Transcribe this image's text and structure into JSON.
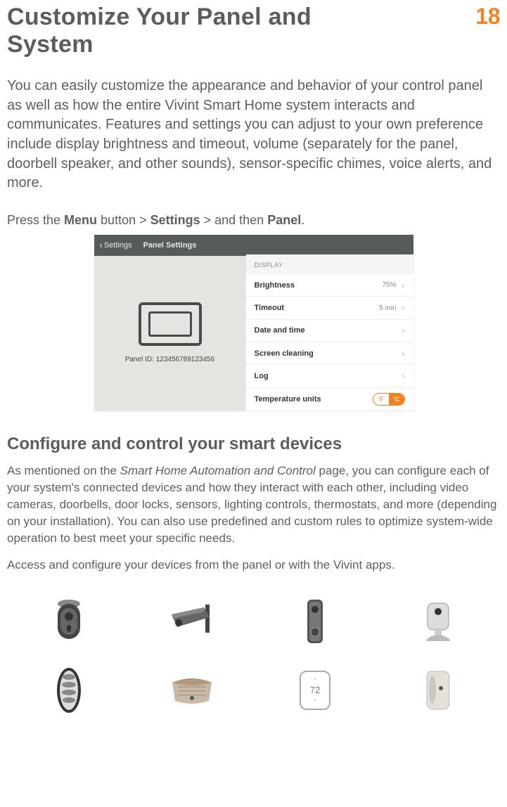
{
  "pageNumber": "18",
  "title": "Customize Your Panel and System",
  "intro": "You can easily customize the appearance and behavior of your control panel as well as how the entire Vivint Smart Home system interacts and communicates. Features and settings you can adjust to your own preference include display brightness and timeout, volume (separately for the panel, doorbell speaker, and other sounds), sensor-specific chimes, voice alerts, and more.",
  "navLine": {
    "prefix": "Press the ",
    "btn1": "Menu",
    "mid1": " button > ",
    "btn2": "Settings",
    "mid2": " > and then ",
    "btn3": "Panel",
    "suffix": "."
  },
  "panel": {
    "backLabel": "Settings",
    "titleLabel": "Panel Settings",
    "panelIdLabel": "Panel ID:",
    "panelIdValue": "123456789123456",
    "sectionLabel": "DISPLAY",
    "rows": {
      "brightness": {
        "label": "Brightness",
        "value": "75%"
      },
      "timeout": {
        "label": "Timeout",
        "value": "5 min"
      },
      "datetime": {
        "label": "Date and time"
      },
      "screen": {
        "label": "Screen cleaning"
      },
      "log": {
        "label": "Log"
      },
      "temp": {
        "label": "Temperature units",
        "f": "°F",
        "c": "°C"
      }
    }
  },
  "subhead": "Configure and control your smart devices",
  "body1a": "As mentioned on the ",
  "body1_em": "Smart Home Automation and Control",
  "body1b": " page, you can configure each of your system's connected devices and how they interact with each other, including video cameras, doorbells, door locks, sensors, lighting controls, thermostats, and more (depending on your installation). You can also use predefined and custom rules to optimize system-wide operation to best meet your specific needs.",
  "body2": "Access and configure your devices from the panel or with the Vivint apps.",
  "thermoValue": "72"
}
